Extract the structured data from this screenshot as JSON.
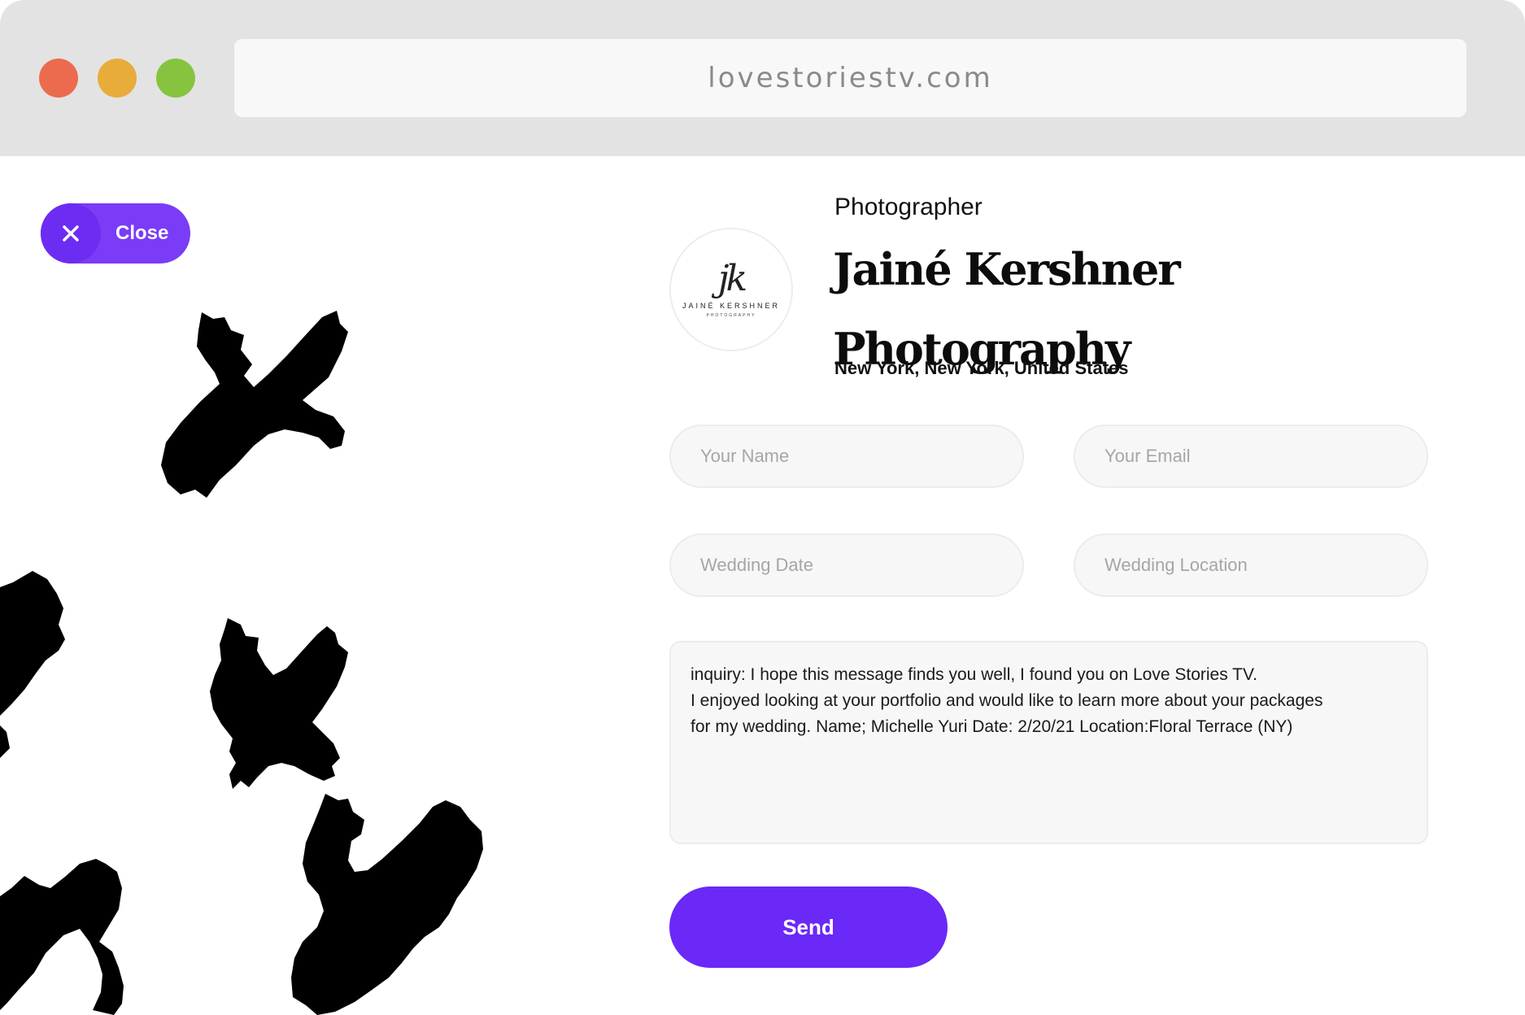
{
  "browser": {
    "url": "lovestoriestv.com"
  },
  "close_button": {
    "label": "Close",
    "icon": "close-icon"
  },
  "profile": {
    "role": "Photographer",
    "name_line1": "Jainé Kershner",
    "name_line2": "Photography",
    "location": "New York, New York, United States",
    "logo": {
      "monogram": "jk",
      "name": "JAINÉ KERSHNER",
      "subtitle": "PHOTOGRAPHY"
    }
  },
  "form": {
    "name_placeholder": "Your Name",
    "email_placeholder": "Your Email",
    "date_placeholder": "Wedding Date",
    "location_placeholder": "Wedding Location",
    "message": "inquiry: I hope this message finds you well, I found you on Love Stories TV.\nI enjoyed looking at your portfolio and would like to learn more about your packages\nfor my wedding. Name; Michelle Yuri Date: 2/20/21 Location:Floral Terrace (NY)",
    "send_label": "Send"
  },
  "colors": {
    "accent": "#6a29f6",
    "chrome": "#e3e3e3",
    "traffic_red": "#ec6b4e",
    "traffic_yellow": "#e8ac3b",
    "traffic_green": "#86c43f"
  }
}
